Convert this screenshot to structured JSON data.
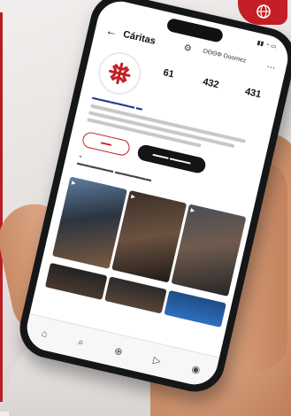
{
  "badge": {
    "icon": "globe-icon",
    "color": "#c41e26"
  },
  "app": {
    "title": "Cáritas",
    "status_time": "",
    "header_name": "ΟΘΘΦ Doomez"
  },
  "profile": {
    "stats": [
      {
        "value": "61",
        "label": ""
      },
      {
        "value": "432",
        "label": ""
      },
      {
        "value": "431",
        "label": ""
      }
    ]
  },
  "colors": {
    "accent": "#c41e26",
    "phone": "#151617"
  },
  "nav": {
    "icons": [
      "home-icon",
      "search-icon",
      "add-icon",
      "reels-icon",
      "profile-icon"
    ]
  }
}
